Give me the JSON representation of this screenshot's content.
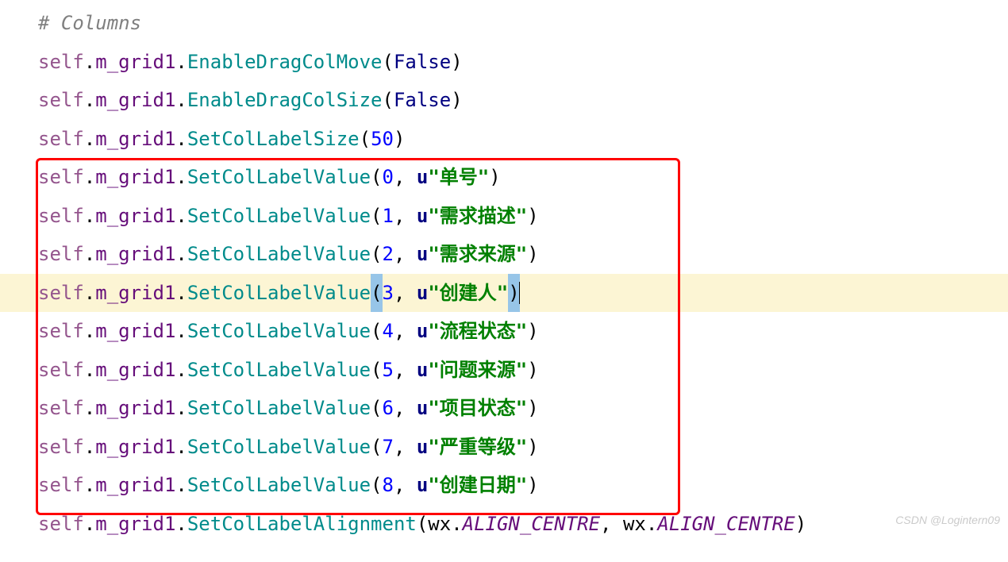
{
  "code": {
    "comment": "# Columns",
    "self": "self",
    "dot": ".",
    "grid": "m_grid1",
    "methods": {
      "enabledragcolmove": "EnableDragColMove",
      "enabledragcolsize": "EnableDragColSize",
      "setcollabelsize": "SetColLabelSize",
      "setcollabelvalue": "SetColLabelValue",
      "setcollabelalignment": "SetColLabelAlignment"
    },
    "lparen": "(",
    "rparen": ")",
    "comma": ", ",
    "false": "False",
    "size50": "50",
    "u": "u",
    "labels": [
      {
        "idx": "0",
        "val": "\"单号\""
      },
      {
        "idx": "1",
        "val": "\"需求描述\""
      },
      {
        "idx": "2",
        "val": "\"需求来源\""
      },
      {
        "idx": "3",
        "val": "\"创建人\""
      },
      {
        "idx": "4",
        "val": "\"流程状态\""
      },
      {
        "idx": "5",
        "val": "\"问题来源\""
      },
      {
        "idx": "6",
        "val": "\"项目状态\""
      },
      {
        "idx": "7",
        "val": "\"严重等级\""
      },
      {
        "idx": "8",
        "val": "\"创建日期\""
      }
    ],
    "wx": "wx",
    "aligncentre": "ALIGN_CENTRE"
  },
  "watermark": "CSDN @Logintern09"
}
